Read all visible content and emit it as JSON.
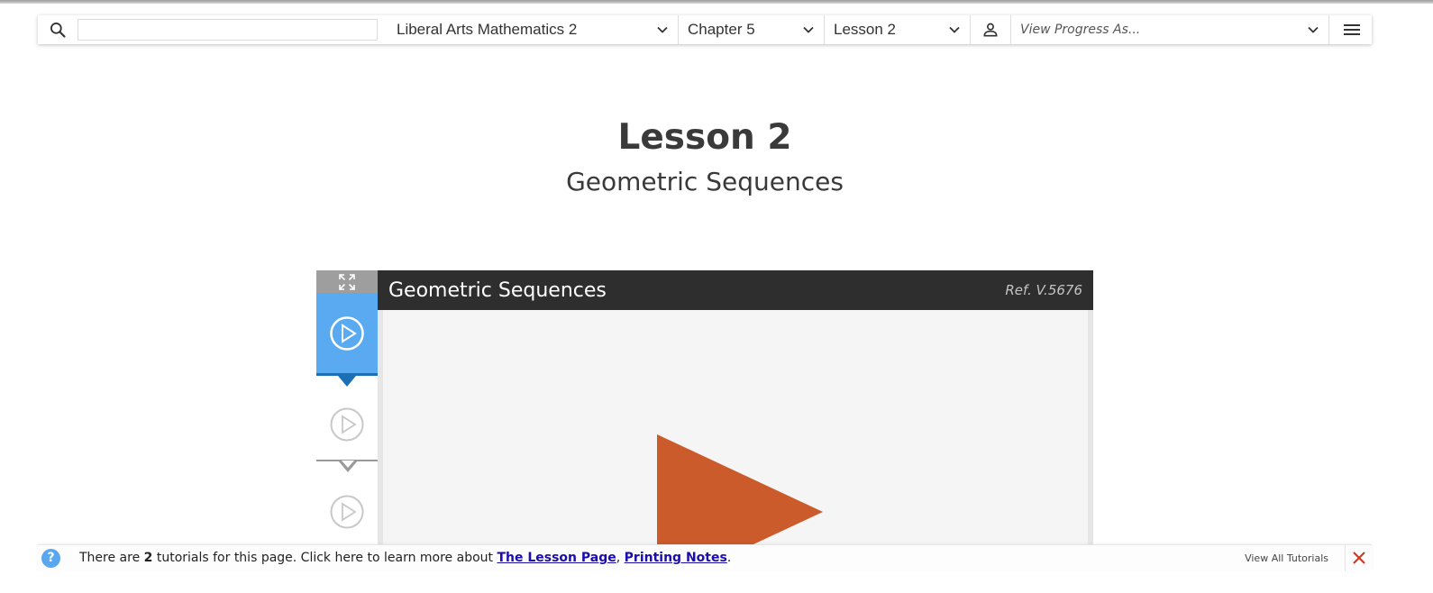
{
  "navbar": {
    "search_placeholder": "",
    "course": "Liberal Arts Mathematics 2",
    "chapter": "Chapter 5",
    "lesson": "Lesson 2",
    "progress_placeholder": "View Progress As..."
  },
  "lesson": {
    "title": "Lesson 2",
    "subtitle": "Geometric Sequences"
  },
  "video": {
    "title": "Geometric Sequences",
    "ref": "Ref. V.5676",
    "tabs_count": 3,
    "active_tab": 1,
    "accent_color": "#5aaaf2",
    "play_color": "#cb5b2a"
  },
  "tutorials": {
    "text_before": "There are ",
    "count": "2",
    "text_after": " tutorials for this page. Click here to learn more about ",
    "link1": "The Lesson Page",
    "separator": ", ",
    "link2": "Printing Notes",
    "end": ".",
    "view_all": "View All Tutorials"
  },
  "icons": [
    "search-icon",
    "chevron-down-icon",
    "user-icon",
    "menu-icon",
    "expand-icon",
    "play-circle-icon",
    "play-icon",
    "help-icon",
    "close-icon"
  ]
}
